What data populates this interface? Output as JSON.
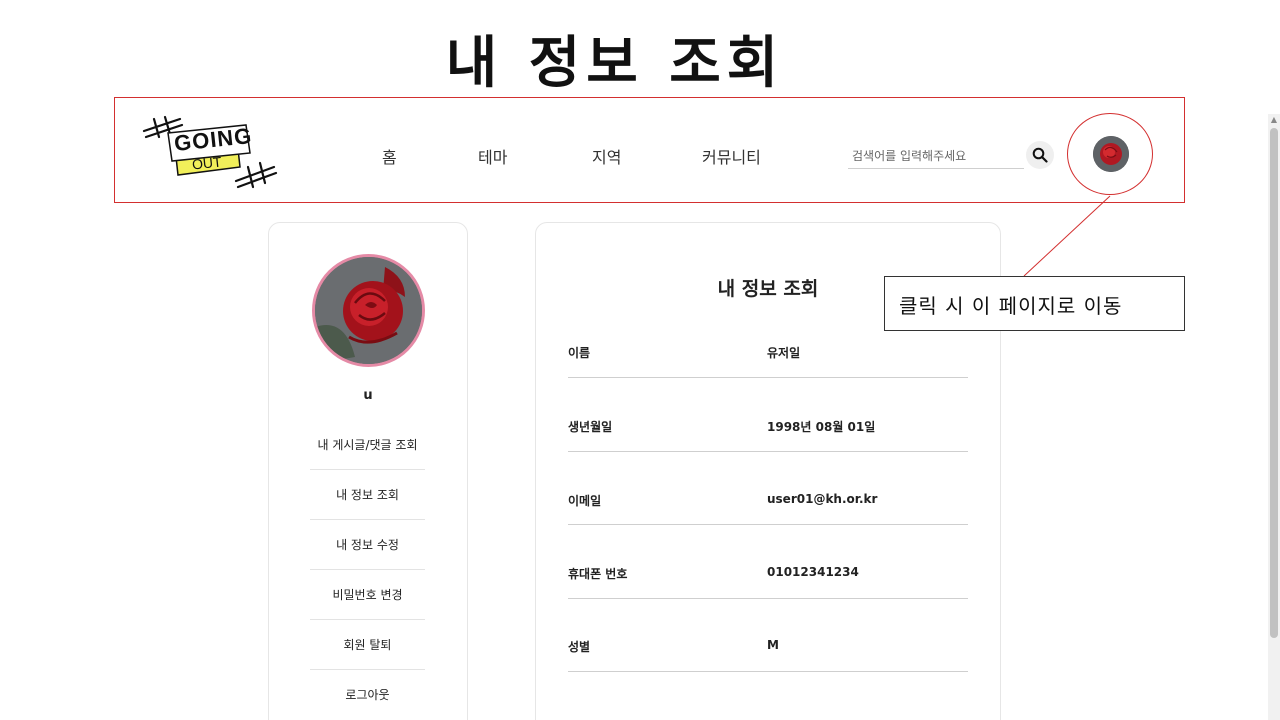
{
  "slide": {
    "title": "내 정보 조회"
  },
  "header": {
    "logo": {
      "top_text": "GOING",
      "bottom_text": "OUT"
    },
    "nav": [
      "홈",
      "테마",
      "지역",
      "커뮤니티"
    ],
    "search": {
      "placeholder": "검색어를 입력해주세요",
      "icon": "search-icon"
    },
    "avatar_icon": "rose-avatar"
  },
  "callout": {
    "text": "클릭 시 이 페이지로 이동"
  },
  "sidebar": {
    "username": "u",
    "menu": [
      "내 게시글/댓글 조회",
      "내 정보 조회",
      "내 정보 수정",
      "비밀번호 변경",
      "회원 탈퇴",
      "로그아웃"
    ]
  },
  "info": {
    "title": "내 정보 조회",
    "rows": [
      {
        "label": "이름",
        "value": "유저일"
      },
      {
        "label": "생년월일",
        "value": "1998년 08월 01일"
      },
      {
        "label": "이메일",
        "value": "user01@kh.or.kr"
      },
      {
        "label": "휴대폰 번호",
        "value": "01012341234"
      },
      {
        "label": "성별",
        "value": "M"
      }
    ]
  },
  "colors": {
    "annotation": "#d32f2f",
    "avatar_border": "#e58aa6",
    "logo_yellow": "#f1ef5a"
  }
}
